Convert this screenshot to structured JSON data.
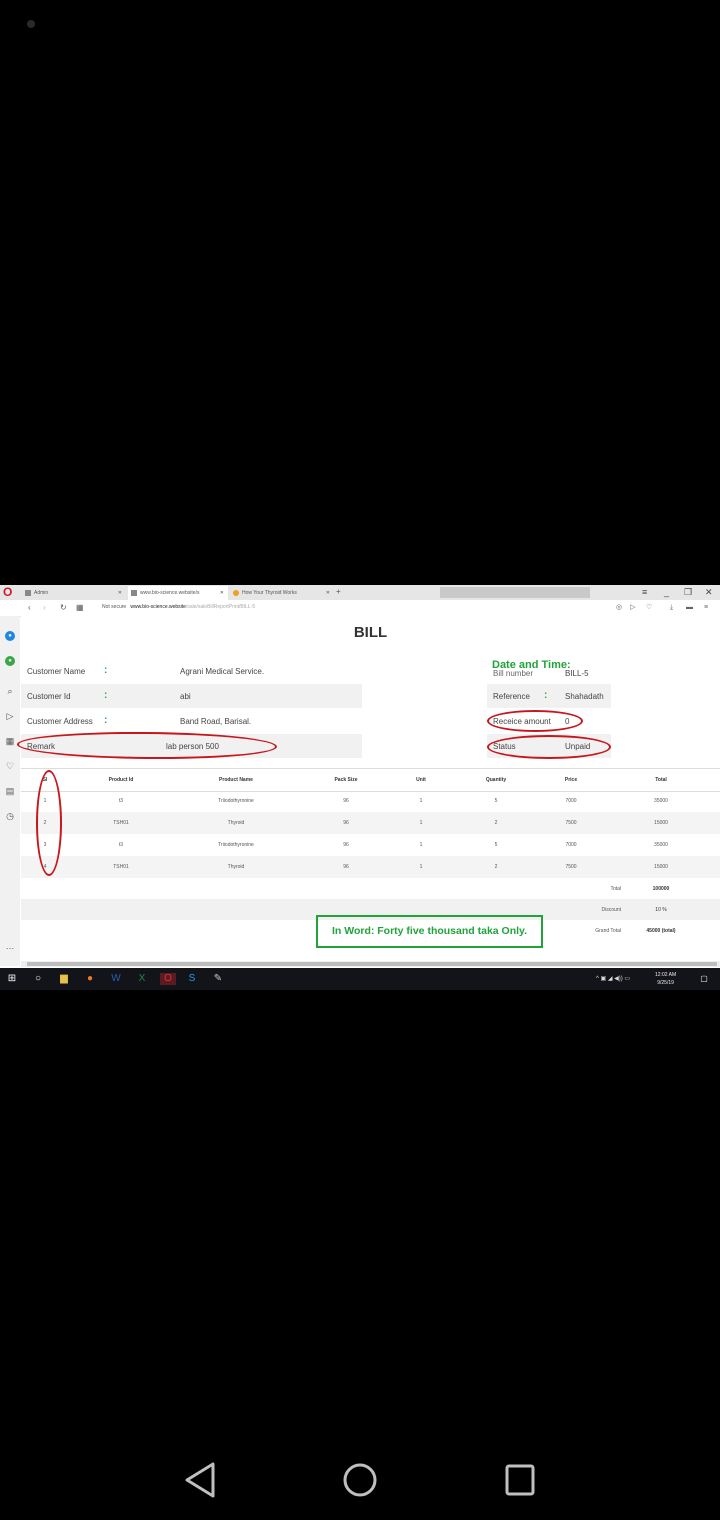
{
  "browser": {
    "tabs": [
      {
        "label": "Admin"
      },
      {
        "label": "www.bio-science.website/s"
      },
      {
        "label": "How Your Thyroid Works"
      }
    ],
    "new_tab": "+",
    "security": "Not secure",
    "url_host": "www.bio-science.website",
    "url_path": "/sale/saleBillReportPrint/BILL-5"
  },
  "bill": {
    "title": "BILL",
    "customer_name_label": "Customer Name",
    "customer_name": "Agrani Medical Service.",
    "customer_id_label": "Customer Id",
    "customer_id": "abi",
    "customer_address_label": "Customer Address",
    "customer_address": "Band Road, Barisal.",
    "remark_label": "Remark",
    "remark": "lab person 500",
    "colon": ":",
    "date_time_label": "Date and Time:",
    "bill_number_label": "Bill number",
    "bill_number": "BILL-5",
    "reference_label": "Reference",
    "reference": "Shahadath",
    "receive_amount_label": "Receice amount",
    "receive_amount": "0",
    "status_label": "Status",
    "status": "Unpaid"
  },
  "table": {
    "headers": [
      "Sl",
      "Product Id",
      "Product Name",
      "Pack Size",
      "Unit",
      "Quantity",
      "Price",
      "Total"
    ],
    "rows": [
      [
        "1",
        "t3",
        "Triiodothyronine",
        "96",
        "1",
        "5",
        "7000",
        "35000"
      ],
      [
        "2",
        "TSH01",
        "Thyroid",
        "96",
        "1",
        "2",
        "7500",
        "15000"
      ],
      [
        "3",
        "t3",
        "Triiodothyronine",
        "96",
        "1",
        "5",
        "7000",
        "35000"
      ],
      [
        "4",
        "TSH01",
        "Thyroid",
        "96",
        "1",
        "2",
        "7500",
        "15000"
      ]
    ],
    "total_label": "Total",
    "total": "100000",
    "discount_label": "Discount",
    "discount": "10 %",
    "grand_total_label": "Grand Total",
    "grand_total": "45000 (total)"
  },
  "in_word": "In Word: Forty five thousand taka Only.",
  "taskbar": {
    "time": "12:02 AM",
    "date": "9/25/19"
  },
  "colors": {
    "accent_green": "#21a33a",
    "annotation_red": "#c8161d",
    "opera_red": "#d01a1f"
  }
}
